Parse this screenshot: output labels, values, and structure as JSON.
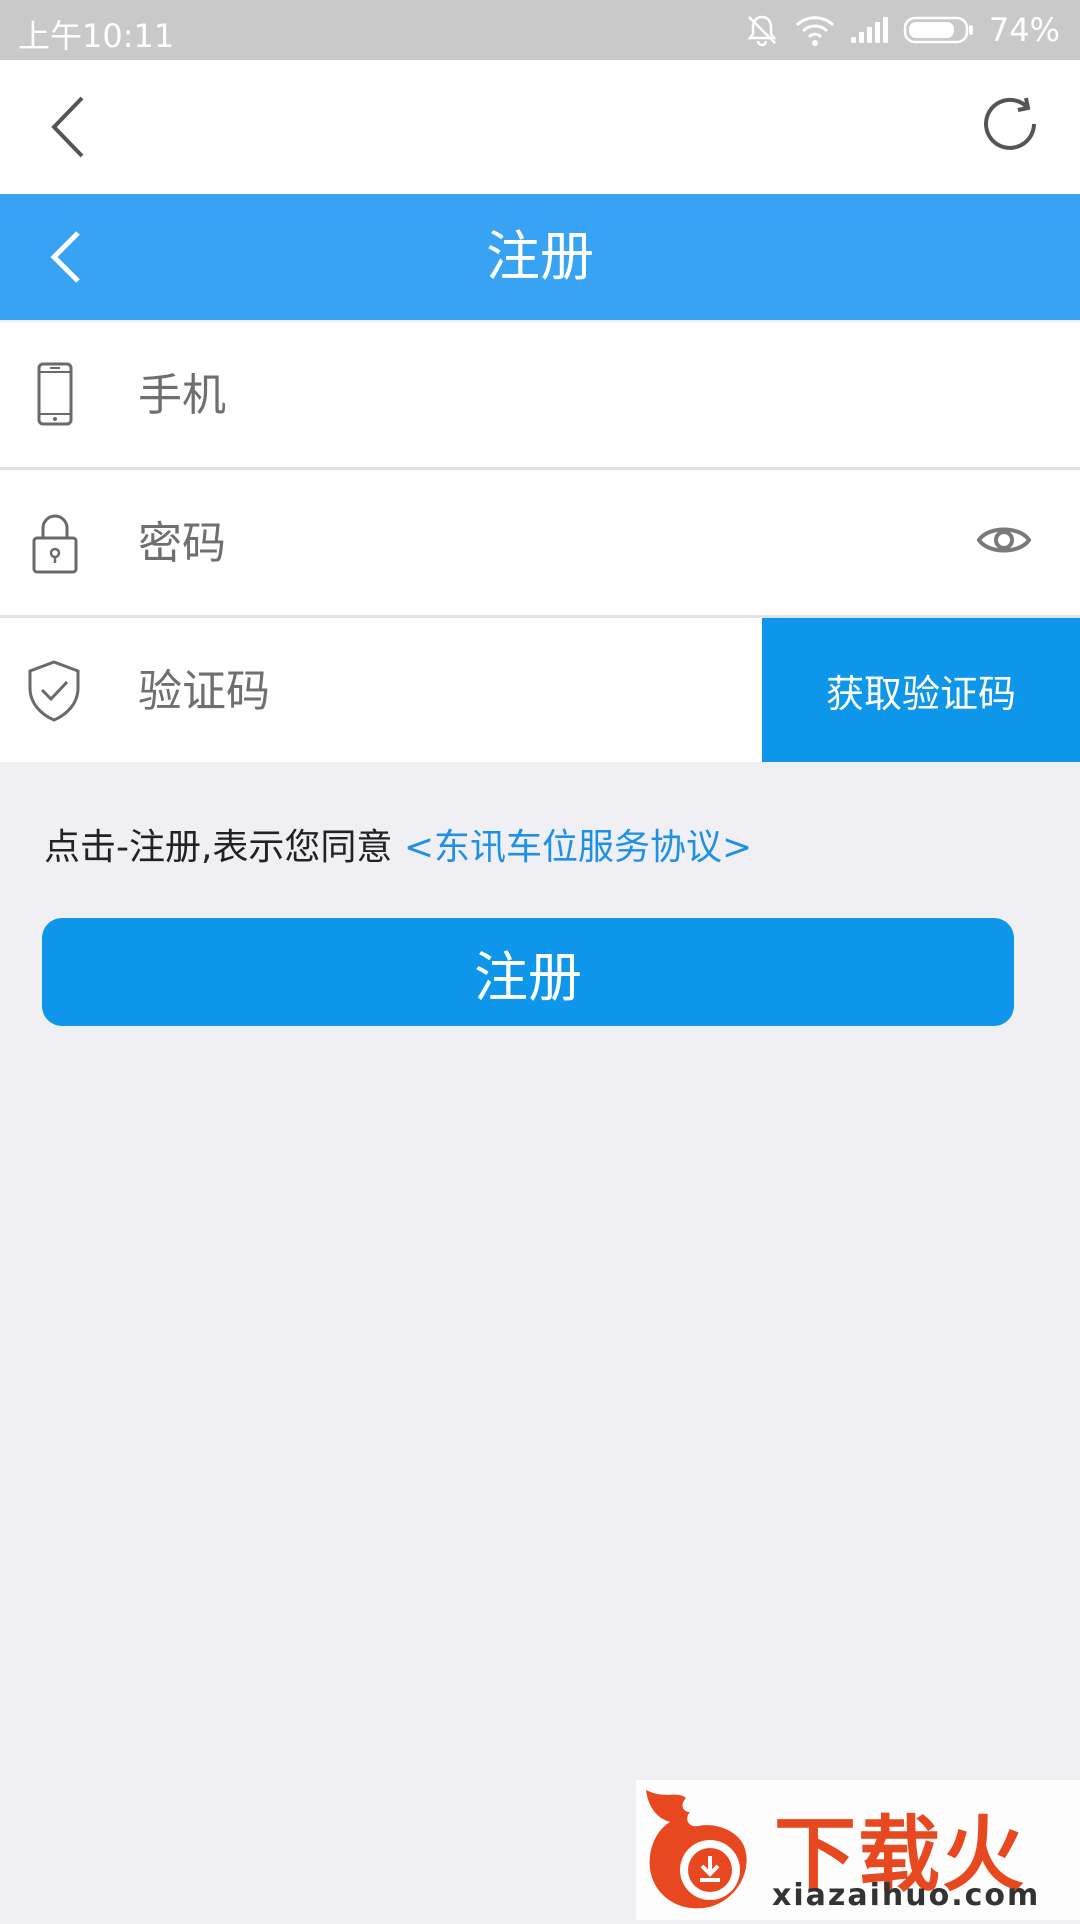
{
  "status_bar": {
    "time": "上午10:11",
    "battery": "74%"
  },
  "icons": {
    "mute": "bell-off-icon",
    "wifi": "wifi-icon",
    "signal": "signal-icon",
    "battery": "battery-icon",
    "browser_back": "chevron-left-icon",
    "refresh": "refresh-icon",
    "phone": "phone-icon",
    "lock": "lock-icon",
    "eye": "eye-icon",
    "shield": "shield-check-icon"
  },
  "header": {
    "title": "注册"
  },
  "form": {
    "phone_placeholder": "手机",
    "password_placeholder": "密码",
    "code_placeholder": "验证码",
    "get_code_label": "获取验证码"
  },
  "agreement": {
    "prefix": "点击-注册,表示您同意 ",
    "link": "<东讯车位服务协议>"
  },
  "register_button": "注册",
  "watermark": {
    "brand": "下载火",
    "url": "xiazaihuo.com"
  },
  "colors": {
    "header": "#37a3f2",
    "button": "#0e96ea",
    "link": "#1e90e6",
    "background": "#efeff4"
  }
}
